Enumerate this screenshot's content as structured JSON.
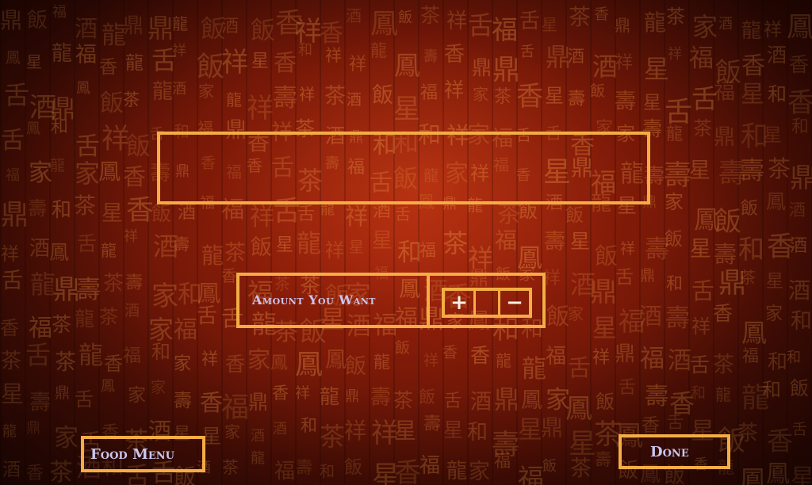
{
  "background": {
    "style": "red chinese calligraphy wall",
    "glyphs": [
      "壽",
      "龍",
      "福",
      "舌",
      "香",
      "家",
      "鼎",
      "鳳",
      "和",
      "祥",
      "星",
      "飯",
      "茶",
      "酒"
    ]
  },
  "title_panel": {
    "text": ""
  },
  "amount": {
    "label": "Amount You Want",
    "value": "",
    "plus_label": "+",
    "minus_label": "−"
  },
  "footer": {
    "food_menu_label": "Food Menu",
    "done_label": "Done"
  },
  "colors": {
    "frame": "#f3ad44",
    "label_text": "#c9c6ee",
    "background": "#8e1f0a"
  }
}
